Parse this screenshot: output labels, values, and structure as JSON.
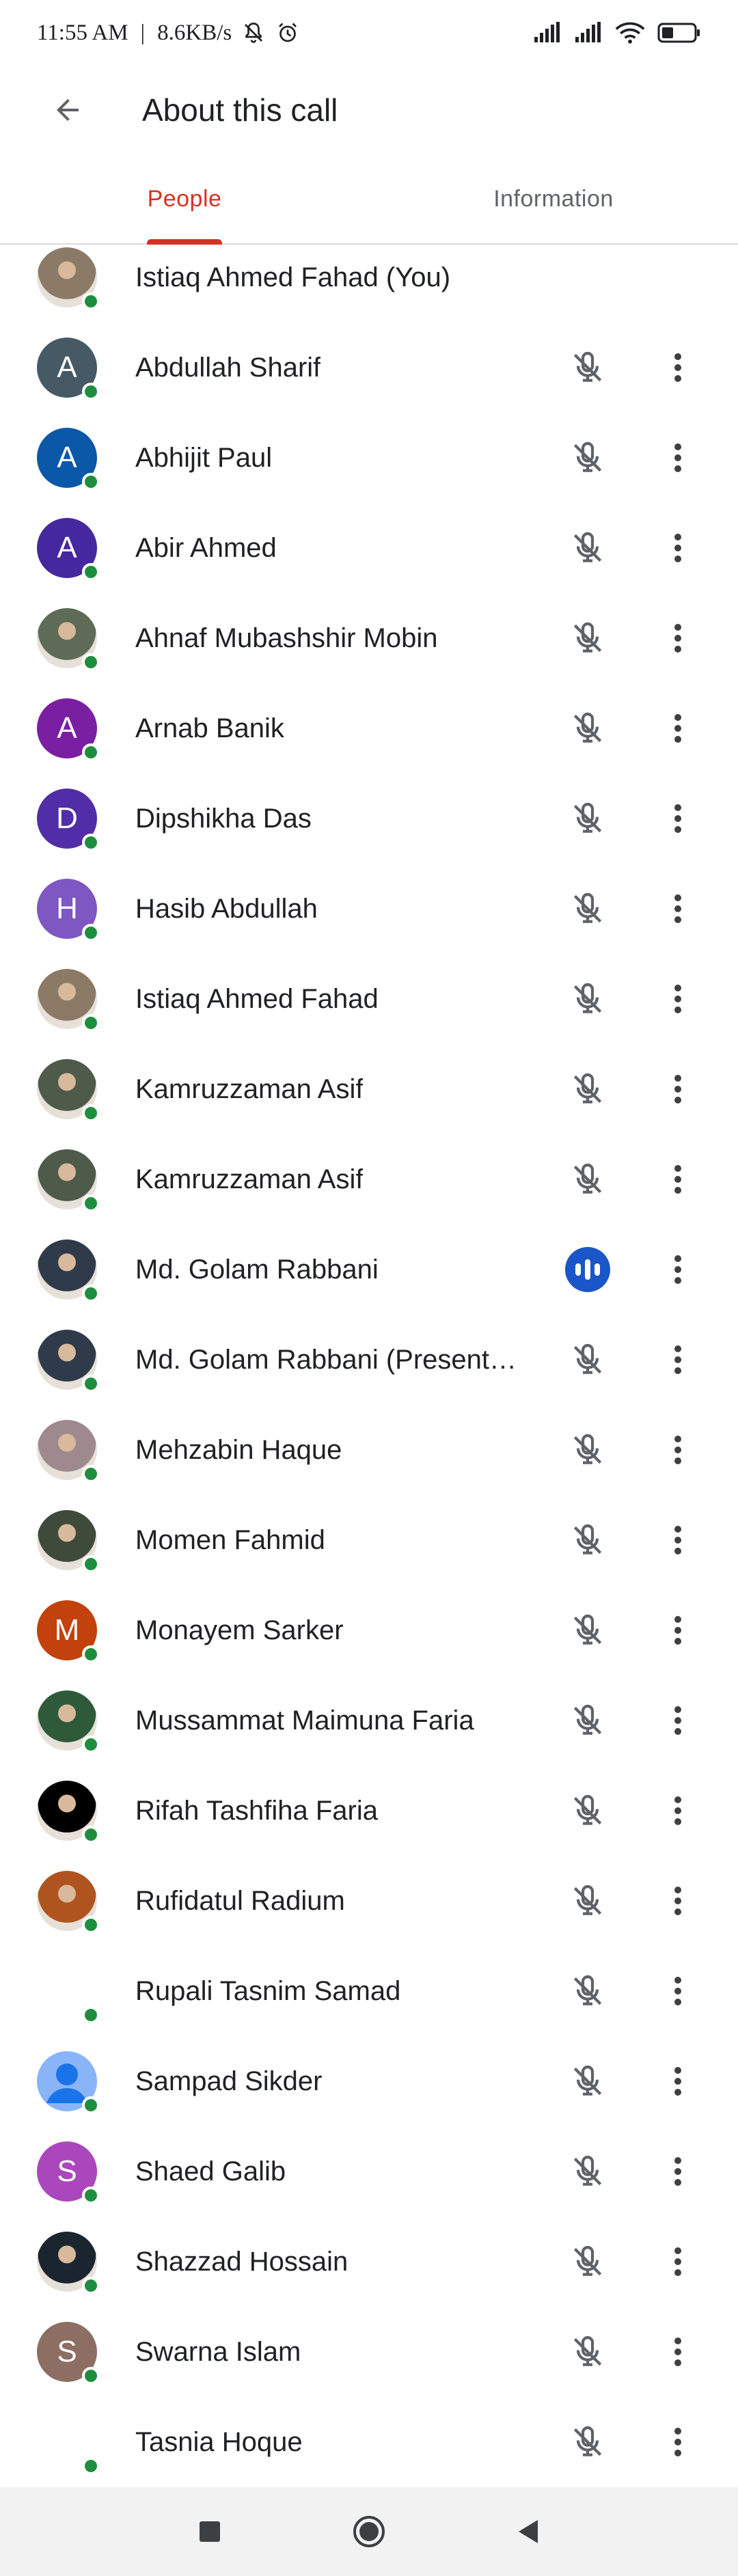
{
  "status_bar": {
    "time": "11:55 AM",
    "network_speed": "8.6KB/s",
    "icons": [
      "mute-notifications-icon",
      "alarm-icon",
      "signal-icon",
      "signal-icon",
      "wifi-icon",
      "battery-icon"
    ]
  },
  "app_bar": {
    "title": "About this call",
    "back_icon": "arrow-left-icon"
  },
  "tabs": [
    {
      "label": "People",
      "active": true
    },
    {
      "label": "Information",
      "active": false
    }
  ],
  "colors": {
    "accent_red": "#d93025",
    "presence_green": "#1e8e3e",
    "speaking_blue": "#1a56c8",
    "muted_icon": "#5f6368"
  },
  "participants": [
    {
      "name": "Istiaq Ahmed Fahad (You)",
      "avatar": "photo",
      "avatar_color": "#8a7a66",
      "mic": "none"
    },
    {
      "name": "Abdullah Sharif",
      "avatar": "letter",
      "initial": "A",
      "avatar_color": "#455a64",
      "mic": "muted"
    },
    {
      "name": "Abhijit Paul",
      "avatar": "letter",
      "initial": "A",
      "avatar_color": "#0b57a8",
      "mic": "muted"
    },
    {
      "name": "Abir Ahmed",
      "avatar": "letter",
      "initial": "A",
      "avatar_color": "#4527a0",
      "mic": "muted"
    },
    {
      "name": "Ahnaf Mubashshir Mobin",
      "avatar": "photo",
      "avatar_color": "#5d6b57",
      "mic": "muted"
    },
    {
      "name": "Arnab Banik",
      "avatar": "letter",
      "initial": "A",
      "avatar_color": "#7b1fa2",
      "mic": "muted"
    },
    {
      "name": "Dipshikha Das",
      "avatar": "letter",
      "initial": "D",
      "avatar_color": "#512da8",
      "mic": "muted"
    },
    {
      "name": "Hasib Abdullah",
      "avatar": "letter",
      "initial": "H",
      "avatar_color": "#7e57c2",
      "mic": "muted"
    },
    {
      "name": "Istiaq Ahmed Fahad",
      "avatar": "photo",
      "avatar_color": "#8a7a66",
      "mic": "muted"
    },
    {
      "name": "Kamruzzaman Asif",
      "avatar": "photo",
      "avatar_color": "#4e5a4a",
      "mic": "muted"
    },
    {
      "name": "Kamruzzaman Asif",
      "avatar": "photo",
      "avatar_color": "#4e5a4a",
      "mic": "muted"
    },
    {
      "name": "Md. Golam Rabbani",
      "avatar": "photo",
      "avatar_color": "#2f3b4a",
      "mic": "speaking"
    },
    {
      "name": "Md. Golam Rabbani (Present…",
      "avatar": "photo",
      "avatar_color": "#2f3b4a",
      "mic": "muted"
    },
    {
      "name": "Mehzabin Haque",
      "avatar": "photo",
      "avatar_color": "#9e8a8e",
      "mic": "muted"
    },
    {
      "name": "Momen Fahmid",
      "avatar": "photo",
      "avatar_color": "#3e4a3a",
      "mic": "muted"
    },
    {
      "name": "Monayem Sarker",
      "avatar": "letter",
      "initial": "M",
      "avatar_color": "#c2410c",
      "mic": "muted"
    },
    {
      "name": "Mussammat Maimuna Faria",
      "avatar": "photo",
      "avatar_color": "#2e5a3a",
      "mic": "muted"
    },
    {
      "name": "Rifah Tashfiha Faria",
      "avatar": "photo",
      "avatar_color": "#000000",
      "mic": "muted"
    },
    {
      "name": "Rufidatul Radium",
      "avatar": "photo",
      "avatar_color": "#b0541f",
      "mic": "muted"
    },
    {
      "name": "Rupali Tasnim Samad",
      "avatar": "photo",
      "avatar_color": "#ffffff",
      "mic": "muted"
    },
    {
      "name": "Sampad Sikder",
      "avatar": "default",
      "avatar_color": "#8ab4f8",
      "mic": "muted"
    },
    {
      "name": "Shaed Galib",
      "avatar": "letter",
      "initial": "S",
      "avatar_color": "#ab47bc",
      "mic": "muted"
    },
    {
      "name": "Shazzad Hossain",
      "avatar": "photo",
      "avatar_color": "#1b2530",
      "mic": "muted"
    },
    {
      "name": "Swarna Islam",
      "avatar": "letter",
      "initial": "S",
      "avatar_color": "#8d6e63",
      "mic": "muted"
    },
    {
      "name": "Tasnia Hoque",
      "avatar": "photo",
      "avatar_color": "#ffffff",
      "mic": "muted"
    }
  ],
  "nav_bar": {
    "buttons": [
      "recents-square-icon",
      "home-circle-icon",
      "back-triangle-icon"
    ]
  }
}
